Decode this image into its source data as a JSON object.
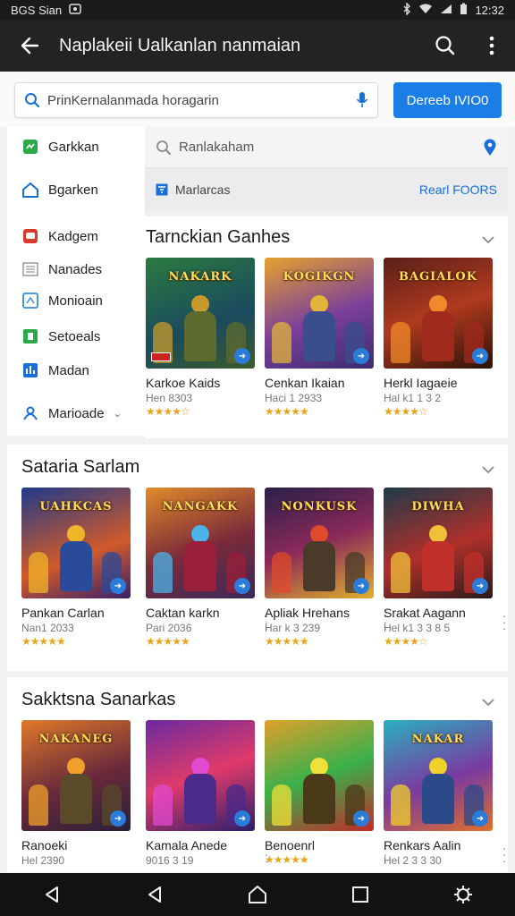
{
  "status": {
    "left_text": "BGS Sian",
    "time": "12:32"
  },
  "appbar": {
    "title": "Naplakeii Ualkanlan nanmaian"
  },
  "search": {
    "value": "PrinKernalanmada horagarin",
    "button_label": "Dereeb IVIO0"
  },
  "subsearch": {
    "value": "Ranlakaham"
  },
  "filter": {
    "label": "Marlarcas",
    "link": "Rearl FOORS"
  },
  "sidebar": {
    "items": [
      {
        "label": "Garkkan",
        "icon": "gamepad-icon",
        "color": "#2aa84a"
      },
      {
        "label": "Bgarken",
        "icon": "home-icon",
        "color": "#1a6fd6"
      },
      {
        "label": "Kadgem",
        "icon": "tv-icon",
        "color": "#d83a2e"
      },
      {
        "label": "Nanades",
        "icon": "list-icon",
        "color": "#9a9a9a"
      },
      {
        "label": "Monioain",
        "icon": "window-icon",
        "color": "#3b8ad6"
      },
      {
        "label": "Setoeals",
        "icon": "settings-icon",
        "color": "#2aa84a"
      },
      {
        "label": "Madan",
        "icon": "chart-icon",
        "color": "#1a6fd6"
      },
      {
        "label": "Marioade",
        "icon": "person-icon",
        "color": "#1a6fd6"
      }
    ]
  },
  "sections": [
    {
      "title": "Tarnckian Ganhes",
      "cards": [
        {
          "name": "Karkoe Kaids",
          "meta": "Hen 8303",
          "stars": "★★★★☆",
          "logo": "NAKARK",
          "bg": "linear-gradient(160deg,#2b7a3f,#1a4a5e 60%,#3c5b2a)",
          "hero": "#5d6b2f",
          "accent": "#c89a2b"
        },
        {
          "name": "Cenkan Ikaian",
          "meta": "Haci 1 2933",
          "stars": "★★★★★",
          "logo": "KOGIKGN",
          "bg": "linear-gradient(160deg,#e6a22d,#7a3f9a 55%,#3a2d6e)",
          "hero": "#3a4e8e",
          "accent": "#e2b43a"
        },
        {
          "name": "Herkl Iagaeie",
          "meta": "Hal k1 1 3 2",
          "stars": "★★★★☆",
          "logo": "BAGIALOK",
          "bg": "linear-gradient(160deg,#5a1f1a,#b03a1e 50%,#2a1208)",
          "hero": "#a02a1c",
          "accent": "#f08a2a"
        }
      ]
    },
    {
      "title": "Sataria Sarlam",
      "cards": [
        {
          "name": "Pankan Carlan",
          "meta": "Nan1 2033",
          "stars": "★★★★★",
          "logo": "UAHKCAS",
          "bg": "linear-gradient(160deg,#1f3a8a,#d05a2a 60%,#3a1f6a)",
          "hero": "#2a4a9a",
          "accent": "#f0b42a"
        },
        {
          "name": "Caktan karkn",
          "meta": "Pari 2036",
          "stars": "★★★★★",
          "logo": "NANGAKK",
          "bg": "linear-gradient(160deg,#e08a2a,#7a2a3a 55%,#3a2a5a)",
          "hero": "#9a1f3a",
          "accent": "#4ab4e8"
        },
        {
          "name": "Apliak Hrehans",
          "meta": "Har k 3 239",
          "stars": "★★★★★",
          "logo": "NONKUSK",
          "bg": "linear-gradient(160deg,#2a1f4a,#8a2a5a 50%,#e0b02a)",
          "hero": "#4a3a2a",
          "accent": "#e04a2a"
        },
        {
          "name": "Srakat Aagann",
          "meta": "Hel k1 3 3 8 5",
          "stars": "★★★★☆",
          "logo": "DIWHA",
          "bg": "linear-gradient(160deg,#1f3a4a,#b0302a 55%,#2a1a1a)",
          "hero": "#c0302a",
          "accent": "#f0c03a"
        }
      ]
    },
    {
      "title": "Sakktsna Sanarkas",
      "cards": [
        {
          "name": "Ranoeki",
          "meta": "Hel 2390",
          "stars": "",
          "logo": "NAKANEG",
          "bg": "linear-gradient(160deg,#e07a2a,#6a2a3a 55%,#2a1f3a)",
          "hero": "#5a4a2a",
          "accent": "#f0a02a"
        },
        {
          "name": "Kamala Anede",
          "meta": "9016 3 19",
          "stars": "",
          "logo": "",
          "bg": "linear-gradient(160deg,#6a2aa0,#e03a6a 50%,#2a1f6a)",
          "hero": "#4a2a8a",
          "accent": "#e04ad0"
        },
        {
          "name": "Benoenrl",
          "meta": "",
          "stars": "★★★★★",
          "logo": "",
          "bg": "linear-gradient(160deg,#e0a02a,#3ab04a 50%,#c02a2a)",
          "hero": "#4a3a1a",
          "accent": "#f0e03a"
        },
        {
          "name": "Renkars Aalin",
          "meta": "Hel 2 3 3 30",
          "stars": "",
          "logo": "NAKAR",
          "bg": "linear-gradient(160deg,#2ab0c0,#7a3aa0 55%,#e0702a)",
          "hero": "#2a4a8a",
          "accent": "#f0d02a"
        }
      ]
    }
  ]
}
